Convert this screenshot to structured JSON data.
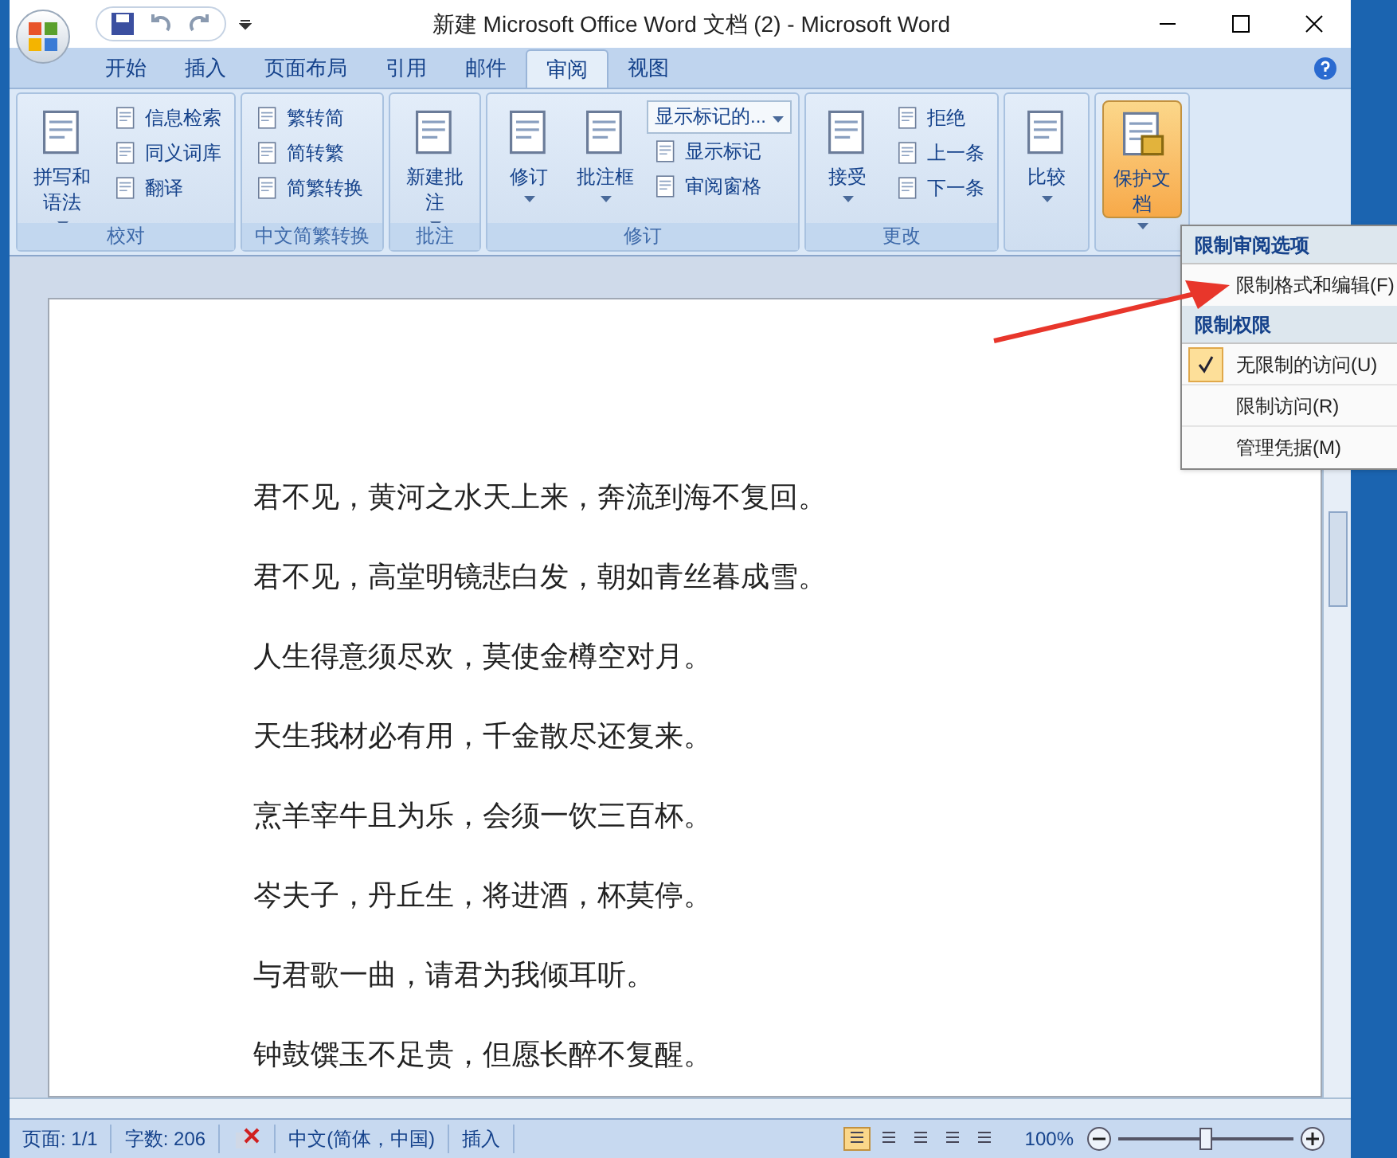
{
  "window": {
    "title": "新建 Microsoft Office Word 文档 (2) - Microsoft Word"
  },
  "tabs": [
    {
      "label": "开始",
      "selected": false
    },
    {
      "label": "插入",
      "selected": false
    },
    {
      "label": "页面布局",
      "selected": false
    },
    {
      "label": "引用",
      "selected": false
    },
    {
      "label": "邮件",
      "selected": false
    },
    {
      "label": "审阅",
      "selected": true
    },
    {
      "label": "视图",
      "selected": false
    }
  ],
  "ribbon_groups": [
    {
      "label": "校对",
      "items": [
        {
          "kind": "large",
          "label": "拼写和语法"
        },
        {
          "kind": "small",
          "label": "信息检索"
        },
        {
          "kind": "small",
          "label": "同义词库"
        },
        {
          "kind": "small",
          "label": "翻译"
        }
      ]
    },
    {
      "label": "中文简繁转换",
      "items": [
        {
          "kind": "small",
          "label": "繁转简"
        },
        {
          "kind": "small",
          "label": "简转繁"
        },
        {
          "kind": "small",
          "label": "简繁转换"
        }
      ]
    },
    {
      "label": "批注",
      "items": [
        {
          "kind": "large",
          "label": "新建批注"
        }
      ]
    },
    {
      "label": "修订",
      "items": [
        {
          "kind": "large",
          "label": "修订"
        },
        {
          "kind": "large",
          "label": "批注框"
        },
        {
          "kind": "combo",
          "label": "显示标记的..."
        },
        {
          "kind": "small",
          "label": "显示标记"
        },
        {
          "kind": "small",
          "label": "审阅窗格"
        }
      ]
    },
    {
      "label": "更改",
      "items": [
        {
          "kind": "large",
          "label": "接受"
        },
        {
          "kind": "small",
          "label": "拒绝"
        },
        {
          "kind": "small",
          "label": "上一条"
        },
        {
          "kind": "small",
          "label": "下一条"
        }
      ]
    },
    {
      "items": [
        {
          "kind": "large",
          "label": "比较"
        }
      ]
    },
    {
      "items": [
        {
          "kind": "large",
          "label": "保护文档",
          "selected": true
        }
      ]
    }
  ],
  "menu": [
    {
      "header": "限制审阅选项",
      "items": [
        {
          "label": "限制格式和编辑(F)",
          "checked": false
        }
      ]
    },
    {
      "header": "限制权限",
      "items": [
        {
          "label": "无限制的访问(U)",
          "checked": true
        },
        {
          "label": "限制访问(R)",
          "checked": false
        },
        {
          "label": "管理凭据(M)",
          "checked": false
        }
      ]
    }
  ],
  "document": {
    "lines": [
      "君不见，黄河之水天上来，奔流到海不复回。",
      "君不见，高堂明镜悲白发，朝如青丝暮成雪。",
      "人生得意须尽欢，莫使金樽空对月。",
      "天生我材必有用，千金散尽还复来。",
      "烹羊宰牛且为乐，会须一饮三百杯。",
      "岑夫子，丹丘生，将进酒，杯莫停。",
      "与君歌一曲，请君为我倾耳听。",
      "钟鼓馔玉不足贵，但愿长醉不复醒。"
    ]
  },
  "status_bar": {
    "page": "页面: 1/1",
    "words": "字数: 206",
    "language": "中文(简体，中国)",
    "mode": "插入",
    "zoom": "100%",
    "zoom_slider": {
      "level": 0.5
    }
  }
}
